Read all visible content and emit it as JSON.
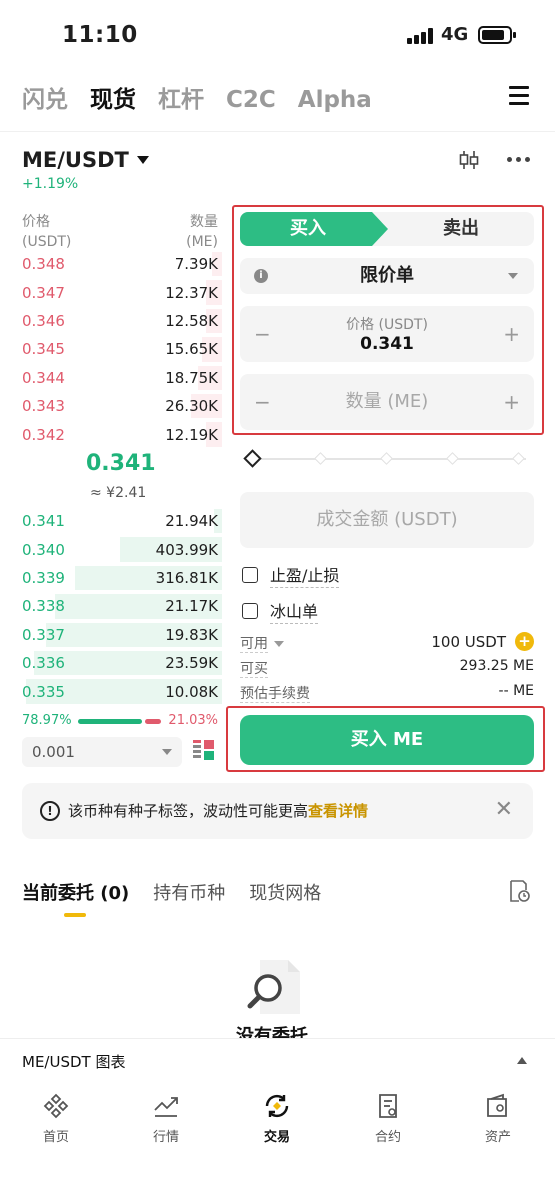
{
  "status": {
    "time": "11:10",
    "network": "4G"
  },
  "top_tabs": [
    {
      "label": "闪兑",
      "active": false
    },
    {
      "label": "现货",
      "active": true
    },
    {
      "label": "杠杆",
      "active": false
    },
    {
      "label": "C2C",
      "active": false
    },
    {
      "label": "Alpha",
      "active": false
    }
  ],
  "pair": {
    "symbol": "ME/USDT",
    "change": "+1.19%"
  },
  "orderbook": {
    "price_label": "价格",
    "price_unit": "(USDT)",
    "qty_label": "数量",
    "qty_unit": "(ME)",
    "asks": [
      {
        "price": "0.348",
        "qty": "7.39K",
        "depth": 0.05
      },
      {
        "price": "0.347",
        "qty": "12.37K",
        "depth": 0.08
      },
      {
        "price": "0.346",
        "qty": "12.58K",
        "depth": 0.08
      },
      {
        "price": "0.345",
        "qty": "15.65K",
        "depth": 0.1
      },
      {
        "price": "0.344",
        "qty": "18.75K",
        "depth": 0.12
      },
      {
        "price": "0.343",
        "qty": "26.30K",
        "depth": 0.16
      },
      {
        "price": "0.342",
        "qty": "12.19K",
        "depth": 0.08
      }
    ],
    "last_price": "0.341",
    "last_price_fiat": "≈ ¥2.41",
    "bids": [
      {
        "price": "0.341",
        "qty": "21.94K",
        "depth": 0.04
      },
      {
        "price": "0.340",
        "qty": "403.99K",
        "depth": 0.52
      },
      {
        "price": "0.339",
        "qty": "316.81K",
        "depth": 0.75
      },
      {
        "price": "0.338",
        "qty": "21.17K",
        "depth": 0.85
      },
      {
        "price": "0.337",
        "qty": "19.83K",
        "depth": 0.9
      },
      {
        "price": "0.336",
        "qty": "23.59K",
        "depth": 0.96
      },
      {
        "price": "0.335",
        "qty": "10.08K",
        "depth": 1.0
      }
    ],
    "buy_ratio": "78.97%",
    "sell_ratio": "21.03%",
    "precision": "0.001"
  },
  "form": {
    "buy_tab": "买入",
    "sell_tab": "卖出",
    "order_type": "限价单",
    "price_label": "价格 (USDT)",
    "price_value": "0.341",
    "qty_placeholder": "数量 (ME)",
    "total_placeholder": "成交金额 (USDT)",
    "tp_sl": "止盈/止损",
    "iceberg": "冰山单",
    "available_label": "可用",
    "available_value": "100 USDT",
    "can_buy_label": "可买",
    "can_buy_value": "293.25 ME",
    "fee_label": "预估手续费",
    "fee_value": "-- ME",
    "buy_button": "买入 ME"
  },
  "notice": {
    "text": "该币种有种子标签，波动性可能更高",
    "link": "查看详情"
  },
  "order_tabs": [
    {
      "label": "当前委托 (0)",
      "active": true
    },
    {
      "label": "持有币种",
      "active": false
    },
    {
      "label": "现货网格",
      "active": false
    }
  ],
  "empty_text": "没有委托",
  "chart_bar": "ME/USDT 图表",
  "nav": [
    {
      "label": "首页",
      "icon": "home-icon"
    },
    {
      "label": "行情",
      "icon": "markets-icon"
    },
    {
      "label": "交易",
      "icon": "trade-icon",
      "active": true
    },
    {
      "label": "合约",
      "icon": "futures-icon"
    },
    {
      "label": "资产",
      "icon": "wallet-icon"
    }
  ]
}
